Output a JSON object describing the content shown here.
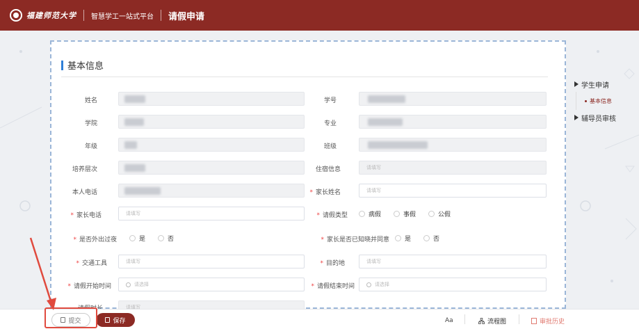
{
  "header": {
    "university_name": "福建师范大学",
    "platform_name": "智慧学工一站式平台",
    "page_title": "请假申请"
  },
  "section": {
    "title": "基本信息"
  },
  "form": {
    "name_label": "姓名",
    "student_id_label": "学号",
    "college_label": "学院",
    "major_label": "专业",
    "grade_label": "年级",
    "class_label": "班级",
    "training_level_label": "培养层次",
    "dorm_label": "住宿信息",
    "dorm_placeholder": "请填写",
    "phone_label": "本人电话",
    "parent_name_label": "家长姓名",
    "parent_name_placeholder": "请填写",
    "parent_phone_label": "家长电话",
    "parent_phone_placeholder": "请填写",
    "leave_type_label": "请假类型",
    "leave_type_options": [
      "病假",
      "事假",
      "公假"
    ],
    "overnight_label": "是否外出过夜",
    "overnight_options": [
      "是",
      "否"
    ],
    "parent_aware_label": "家长是否已知晓并同意",
    "parent_aware_options": [
      "是",
      "否"
    ],
    "transport_label": "交通工具",
    "transport_placeholder": "请填写",
    "destination_label": "目的地",
    "destination_placeholder": "请填写",
    "start_time_label": "请假开始时间",
    "start_time_placeholder": "请选择",
    "end_time_label": "请假结束时间",
    "end_time_placeholder": "请选择",
    "duration_label": "请假时长",
    "duration_placeholder": "请填写"
  },
  "side_nav": {
    "items": [
      {
        "label": "学生申请"
      },
      {
        "label": "基本信息"
      },
      {
        "label": "辅导员审核"
      }
    ]
  },
  "bottom_bar": {
    "submit_label": "提交",
    "save_label": "保存",
    "font_label": "Aa",
    "flow_label": "流程图",
    "history_label": "审批历史"
  },
  "colors": {
    "brand": "#8c2a24",
    "accent_blue": "#2f7fd8",
    "required": "#e44444",
    "annotation_red": "#e04a3e"
  },
  "icons": [
    "university-seal-icon",
    "clock-icon",
    "document-icon",
    "save-icon",
    "flowchart-icon",
    "history-icon",
    "triangle-right-icon"
  ]
}
